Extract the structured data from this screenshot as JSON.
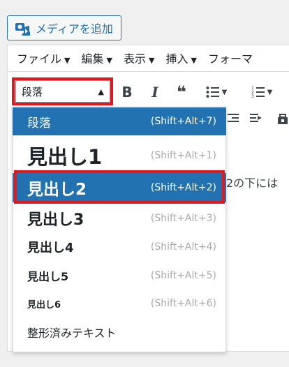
{
  "media_button": {
    "label": "メディアを追加",
    "icon": "media-camera-icon"
  },
  "menubar": {
    "items": [
      "ファイル",
      "編集",
      "表示",
      "挿入",
      "フォーマ"
    ]
  },
  "toolbar": {
    "format_select_value": "段落",
    "icons": [
      "bold-icon",
      "italic-icon",
      "blockquote-icon",
      "bullet-list-icon",
      "numbered-list-icon"
    ],
    "bold_glyph": "B",
    "italic_glyph": "I",
    "quote_glyph": "❝"
  },
  "dropdown": {
    "options": [
      {
        "label": "段落",
        "shortcut": "(Shift+Alt+7)"
      },
      {
        "label": "見出し1",
        "shortcut": "(Shift+Alt+1)"
      },
      {
        "label": "見出し2",
        "shortcut": "(Shift+Alt+2)"
      },
      {
        "label": "見出し3",
        "shortcut": "(Shift+Alt+3)"
      },
      {
        "label": "見出し4",
        "shortcut": "(Shift+Alt+4)"
      },
      {
        "label": "見出し5",
        "shortcut": "(Shift+Alt+5)"
      },
      {
        "label": "見出し6",
        "shortcut": "(Shift+Alt+6)"
      },
      {
        "label": "整形済みテキスト",
        "shortcut": ""
      }
    ],
    "selected_index": 2
  },
  "editor_content_fragment": "2の下には",
  "colors": {
    "accent": "#2271b1",
    "highlight_border": "#e0191f"
  }
}
